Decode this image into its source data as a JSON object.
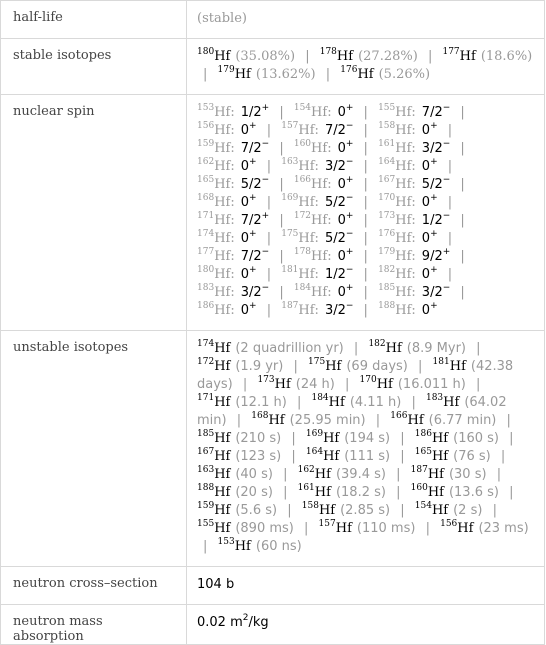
{
  "rows": {
    "half_life": {
      "label": "half-life",
      "value": "(stable)"
    },
    "stable_isotopes": {
      "label": "stable isotopes",
      "items": [
        {
          "mass": "180",
          "symbol": "Hf",
          "abundance": "(35.08%)"
        },
        {
          "mass": "178",
          "symbol": "Hf",
          "abundance": "(27.28%)"
        },
        {
          "mass": "177",
          "symbol": "Hf",
          "abundance": "(18.6%)"
        },
        {
          "mass": "179",
          "symbol": "Hf",
          "abundance": "(13.62%)"
        },
        {
          "mass": "176",
          "symbol": "Hf",
          "abundance": "(5.26%)"
        }
      ]
    },
    "nuclear_spin": {
      "label": "nuclear spin",
      "items": [
        {
          "mass": "153",
          "symbol": "Hf:",
          "spin": "1/2",
          "parity": "+"
        },
        {
          "mass": "154",
          "symbol": "Hf:",
          "spin": "0",
          "parity": "+"
        },
        {
          "mass": "155",
          "symbol": "Hf:",
          "spin": "7/2",
          "parity": "−"
        },
        {
          "mass": "156",
          "symbol": "Hf:",
          "spin": "0",
          "parity": "+"
        },
        {
          "mass": "157",
          "symbol": "Hf:",
          "spin": "7/2",
          "parity": "−"
        },
        {
          "mass": "158",
          "symbol": "Hf:",
          "spin": "0",
          "parity": "+"
        },
        {
          "mass": "159",
          "symbol": "Hf:",
          "spin": "7/2",
          "parity": "−"
        },
        {
          "mass": "160",
          "symbol": "Hf:",
          "spin": "0",
          "parity": "+"
        },
        {
          "mass": "161",
          "symbol": "Hf:",
          "spin": "3/2",
          "parity": "−"
        },
        {
          "mass": "162",
          "symbol": "Hf:",
          "spin": "0",
          "parity": "+"
        },
        {
          "mass": "163",
          "symbol": "Hf:",
          "spin": "3/2",
          "parity": "−"
        },
        {
          "mass": "164",
          "symbol": "Hf:",
          "spin": "0",
          "parity": "+"
        },
        {
          "mass": "165",
          "symbol": "Hf:",
          "spin": "5/2",
          "parity": "−"
        },
        {
          "mass": "166",
          "symbol": "Hf:",
          "spin": "0",
          "parity": "+"
        },
        {
          "mass": "167",
          "symbol": "Hf:",
          "spin": "5/2",
          "parity": "−"
        },
        {
          "mass": "168",
          "symbol": "Hf:",
          "spin": "0",
          "parity": "+"
        },
        {
          "mass": "169",
          "symbol": "Hf:",
          "spin": "5/2",
          "parity": "−"
        },
        {
          "mass": "170",
          "symbol": "Hf:",
          "spin": "0",
          "parity": "+"
        },
        {
          "mass": "171",
          "symbol": "Hf:",
          "spin": "7/2",
          "parity": "+"
        },
        {
          "mass": "172",
          "symbol": "Hf:",
          "spin": "0",
          "parity": "+"
        },
        {
          "mass": "173",
          "symbol": "Hf:",
          "spin": "1/2",
          "parity": "−"
        },
        {
          "mass": "174",
          "symbol": "Hf:",
          "spin": "0",
          "parity": "+"
        },
        {
          "mass": "175",
          "symbol": "Hf:",
          "spin": "5/2",
          "parity": "−"
        },
        {
          "mass": "176",
          "symbol": "Hf:",
          "spin": "0",
          "parity": "+"
        },
        {
          "mass": "177",
          "symbol": "Hf:",
          "spin": "7/2",
          "parity": "−"
        },
        {
          "mass": "178",
          "symbol": "Hf:",
          "spin": "0",
          "parity": "+"
        },
        {
          "mass": "179",
          "symbol": "Hf:",
          "spin": "9/2",
          "parity": "+"
        },
        {
          "mass": "180",
          "symbol": "Hf:",
          "spin": "0",
          "parity": "+"
        },
        {
          "mass": "181",
          "symbol": "Hf:",
          "spin": "1/2",
          "parity": "−"
        },
        {
          "mass": "182",
          "symbol": "Hf:",
          "spin": "0",
          "parity": "+"
        },
        {
          "mass": "183",
          "symbol": "Hf:",
          "spin": "3/2",
          "parity": "−"
        },
        {
          "mass": "184",
          "symbol": "Hf:",
          "spin": "0",
          "parity": "+"
        },
        {
          "mass": "185",
          "symbol": "Hf:",
          "spin": "3/2",
          "parity": "−"
        },
        {
          "mass": "186",
          "symbol": "Hf:",
          "spin": "0",
          "parity": "+"
        },
        {
          "mass": "187",
          "symbol": "Hf:",
          "spin": "3/2",
          "parity": "−"
        },
        {
          "mass": "188",
          "symbol": "Hf:",
          "spin": "0",
          "parity": "+"
        }
      ]
    },
    "unstable_isotopes": {
      "label": "unstable isotopes",
      "items": [
        {
          "mass": "174",
          "symbol": "Hf",
          "half_life": "(2 quadrillion yr)"
        },
        {
          "mass": "182",
          "symbol": "Hf",
          "half_life": "(8.9 Myr)"
        },
        {
          "mass": "172",
          "symbol": "Hf",
          "half_life": "(1.9 yr)"
        },
        {
          "mass": "175",
          "symbol": "Hf",
          "half_life": "(69 days)"
        },
        {
          "mass": "181",
          "symbol": "Hf",
          "half_life": "(42.38 days)"
        },
        {
          "mass": "173",
          "symbol": "Hf",
          "half_life": "(24 h)"
        },
        {
          "mass": "170",
          "symbol": "Hf",
          "half_life": "(16.011 h)"
        },
        {
          "mass": "171",
          "symbol": "Hf",
          "half_life": "(12.1 h)"
        },
        {
          "mass": "184",
          "symbol": "Hf",
          "half_life": "(4.11 h)"
        },
        {
          "mass": "183",
          "symbol": "Hf",
          "half_life": "(64.02 min)"
        },
        {
          "mass": "168",
          "symbol": "Hf",
          "half_life": "(25.95 min)"
        },
        {
          "mass": "166",
          "symbol": "Hf",
          "half_life": "(6.77 min)"
        },
        {
          "mass": "185",
          "symbol": "Hf",
          "half_life": "(210 s)"
        },
        {
          "mass": "169",
          "symbol": "Hf",
          "half_life": "(194 s)"
        },
        {
          "mass": "186",
          "symbol": "Hf",
          "half_life": "(160 s)"
        },
        {
          "mass": "167",
          "symbol": "Hf",
          "half_life": "(123 s)"
        },
        {
          "mass": "164",
          "symbol": "Hf",
          "half_life": "(111 s)"
        },
        {
          "mass": "165",
          "symbol": "Hf",
          "half_life": "(76 s)"
        },
        {
          "mass": "163",
          "symbol": "Hf",
          "half_life": "(40 s)"
        },
        {
          "mass": "162",
          "symbol": "Hf",
          "half_life": "(39.4 s)"
        },
        {
          "mass": "187",
          "symbol": "Hf",
          "half_life": "(30 s)"
        },
        {
          "mass": "188",
          "symbol": "Hf",
          "half_life": "(20 s)"
        },
        {
          "mass": "161",
          "symbol": "Hf",
          "half_life": "(18.2 s)"
        },
        {
          "mass": "160",
          "symbol": "Hf",
          "half_life": "(13.6 s)"
        },
        {
          "mass": "159",
          "symbol": "Hf",
          "half_life": "(5.6 s)"
        },
        {
          "mass": "158",
          "symbol": "Hf",
          "half_life": "(2.85 s)"
        },
        {
          "mass": "154",
          "symbol": "Hf",
          "half_life": "(2 s)"
        },
        {
          "mass": "155",
          "symbol": "Hf",
          "half_life": "(890 ms)"
        },
        {
          "mass": "157",
          "symbol": "Hf",
          "half_life": "(110 ms)"
        },
        {
          "mass": "156",
          "symbol": "Hf",
          "half_life": "(23 ms)"
        },
        {
          "mass": "153",
          "symbol": "Hf",
          "half_life": "(60 ns)"
        }
      ]
    },
    "neutron_cross_section": {
      "label": "neutron cross–section",
      "value": "104 b"
    },
    "neutron_mass_absorption": {
      "label": "neutron mass absorption",
      "value_prefix": "0.02 m",
      "value_sup": "2",
      "value_suffix": "/kg"
    }
  },
  "separator": "|"
}
